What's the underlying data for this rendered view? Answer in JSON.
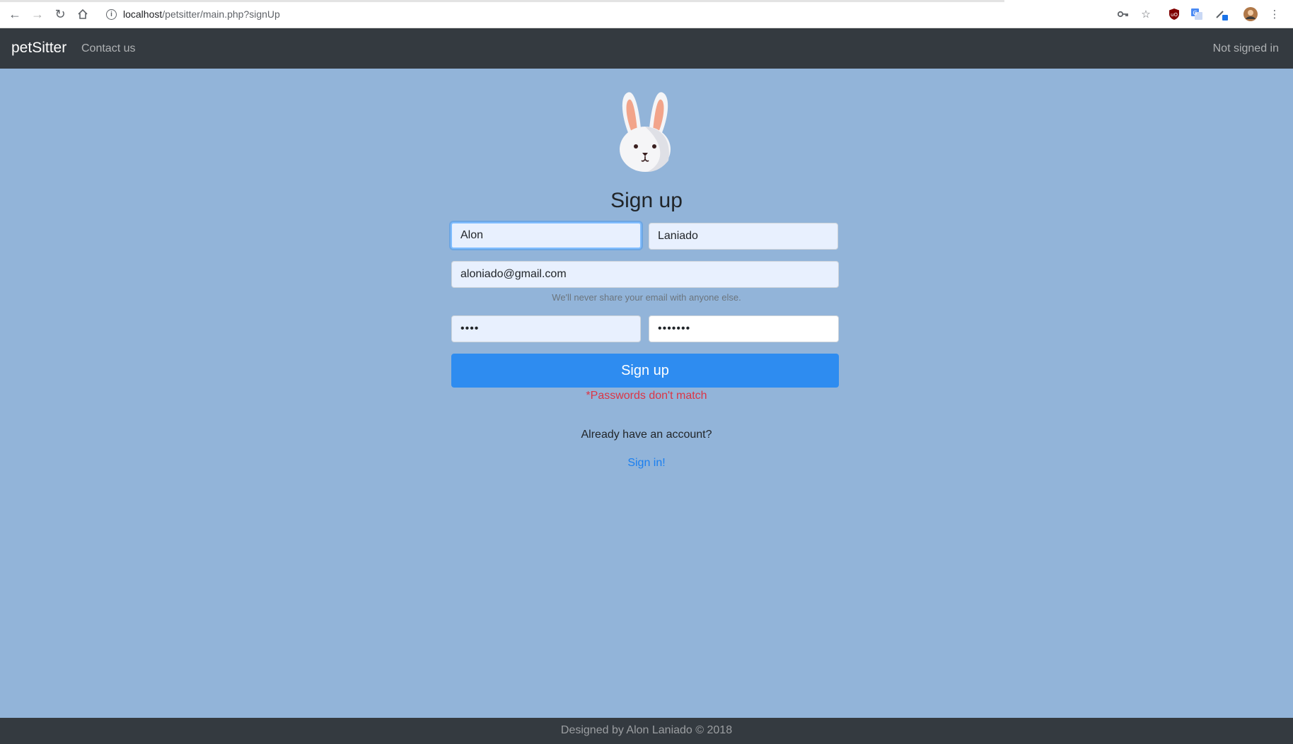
{
  "browser": {
    "url_host": "localhost",
    "url_path": "/petsitter/main.php?signUp"
  },
  "navbar": {
    "brand": "petSitter",
    "contact_link": "Contact us",
    "status": "Not signed in"
  },
  "form": {
    "title": "Sign up",
    "first_name": "Alon",
    "last_name": "Laniado",
    "email": "aloniado@gmail.com",
    "email_hint": "We'll never share your email with anyone else.",
    "password_mask": "••••",
    "confirm_password_mask": "•••••••",
    "submit_label": "Sign up",
    "error_message": "*Passwords don't match",
    "already_text": "Already have an account?",
    "signin_link": "Sign in!"
  },
  "footer": {
    "text": "Designed by Alon Laniado © 2018"
  },
  "colors": {
    "page_background": "#92b4d9",
    "navbar": "#343a40",
    "primary_button": "#2e8cf0",
    "error": "#dc3545"
  }
}
